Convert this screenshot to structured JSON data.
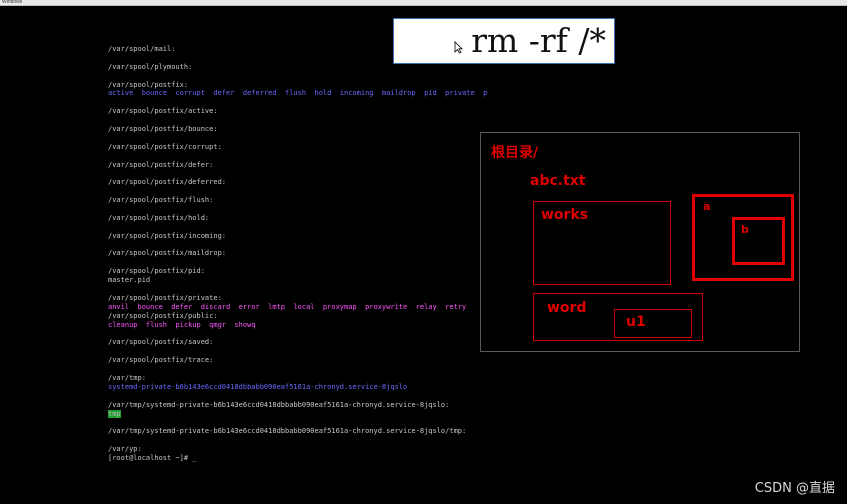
{
  "window": {
    "title": "Windows"
  },
  "terminal": {
    "lines": [
      {
        "text": "/var/spool/mail:",
        "color": "gray"
      },
      {
        "text": "",
        "color": "gray"
      },
      {
        "text": "/var/spool/plymouth:",
        "color": "gray"
      },
      {
        "text": "",
        "color": "gray"
      },
      {
        "text": "/var/spool/postfix:",
        "color": "gray"
      },
      {
        "text": "active  bounce  corrupt  defer  deferred  flush  hold  incoming  maildrop  pid  private  public  saved  trace",
        "color": "blue"
      },
      {
        "text": "",
        "color": "gray"
      },
      {
        "text": "/var/spool/postfix/active:",
        "color": "gray"
      },
      {
        "text": "",
        "color": "gray"
      },
      {
        "text": "/var/spool/postfix/bounce:",
        "color": "gray"
      },
      {
        "text": "",
        "color": "gray"
      },
      {
        "text": "/var/spool/postfix/corrupt:",
        "color": "gray"
      },
      {
        "text": "",
        "color": "gray"
      },
      {
        "text": "/var/spool/postfix/defer:",
        "color": "gray"
      },
      {
        "text": "",
        "color": "gray"
      },
      {
        "text": "/var/spool/postfix/deferred:",
        "color": "gray"
      },
      {
        "text": "",
        "color": "gray"
      },
      {
        "text": "/var/spool/postfix/flush:",
        "color": "gray"
      },
      {
        "text": "",
        "color": "gray"
      },
      {
        "text": "/var/spool/postfix/hold:",
        "color": "gray"
      },
      {
        "text": "",
        "color": "gray"
      },
      {
        "text": "/var/spool/postfix/incoming:",
        "color": "gray"
      },
      {
        "text": "",
        "color": "gray"
      },
      {
        "text": "/var/spool/postfix/maildrop:",
        "color": "gray"
      },
      {
        "text": "",
        "color": "gray"
      },
      {
        "text": "/var/spool/postfix/pid:",
        "color": "gray"
      },
      {
        "text": "master.pid",
        "color": "gray"
      },
      {
        "text": "",
        "color": "gray"
      },
      {
        "text": "/var/spool/postfix/private:",
        "color": "gray"
      },
      {
        "text": "anvil  bounce  defer  discard  error  lmtp  local  proxymap  proxywrite  relay  retry",
        "color": "magenta"
      },
      {
        "text": "/var/spool/postfix/public:",
        "color": "gray"
      },
      {
        "text": "cleanup  flush  pickup  qmgr  showq",
        "color": "magenta"
      },
      {
        "text": "",
        "color": "gray"
      },
      {
        "text": "/var/spool/postfix/saved:",
        "color": "gray"
      },
      {
        "text": "",
        "color": "gray"
      },
      {
        "text": "/var/spool/postfix/trace:",
        "color": "gray"
      },
      {
        "text": "",
        "color": "gray"
      },
      {
        "text": "/var/tmp:",
        "color": "gray"
      },
      {
        "text": "systemd-private-b6b143e6ccd0418dbbabb090eaf5161a-chronyd.service-8jqslo",
        "color": "blue"
      },
      {
        "text": "",
        "color": "gray"
      },
      {
        "text": "/var/tmp/systemd-private-b6b143e6ccd0418dbbabb090eaf5161a-chronyd.service-8jqslo:",
        "color": "gray"
      },
      {
        "text": "tmp",
        "color": "highlight"
      },
      {
        "text": "",
        "color": "gray"
      },
      {
        "text": "/var/tmp/systemd-private-b6b143e6ccd0418dbbabb090eaf5161a-chronyd.service-8jqslo/tmp:",
        "color": "gray"
      },
      {
        "text": "",
        "color": "gray"
      },
      {
        "text": "/var/yp:",
        "color": "gray"
      },
      {
        "text": "[root@localhost ~]# _",
        "color": "gray"
      }
    ]
  },
  "command_callout": {
    "text": "rm -rf /*"
  },
  "diagram": {
    "root_label": "根目录/",
    "file_label": "abc.txt",
    "works_label": "works",
    "a_label": "a",
    "b_label": "b",
    "word_label": "word",
    "u1_label": "u1"
  },
  "watermark": {
    "text": "CSDN @直据"
  },
  "colors": {
    "terminal_gray": "#c8c8c8",
    "terminal_blue": "#6a6aff",
    "terminal_magenta": "#ff55ff",
    "highlight_green": "#1f9e2b",
    "diagram_red": "#e00000"
  }
}
